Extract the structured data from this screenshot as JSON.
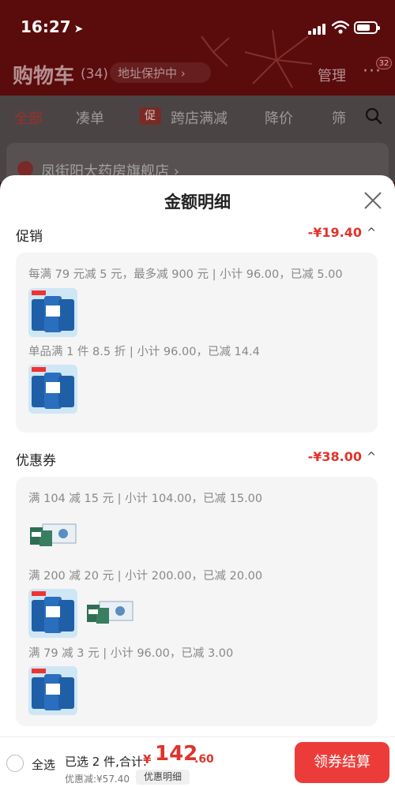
{
  "status_bar": {
    "time": "16:27"
  },
  "header": {
    "title": "购物车",
    "count": "(34)",
    "address_protection": "地址保护中 ›",
    "manage": "管理",
    "more_badge": "32"
  },
  "tabs": [
    {
      "label": "全部"
    },
    {
      "label": "凑单"
    },
    {
      "label": "跨店满减"
    },
    {
      "label": "降价"
    },
    {
      "label": "筛"
    }
  ],
  "promo_tag": "促",
  "store": {
    "name": "凤街阳大药房旗舰店 ›"
  },
  "sheet": {
    "title": "金额明细",
    "promotion": {
      "name": "促销",
      "amount": "-¥19.40",
      "rules": [
        "每满 79 元减 5 元，最多减 900 元 | 小计 96.00，已减 5.00",
        "单品满 1 件 8.5 折 | 小计 96.00，已减 14.4"
      ]
    },
    "coupon": {
      "name": "优惠券",
      "amount": "-¥38.00",
      "rules": [
        "满 104 减 15 元 | 小计 104.00，已减 15.00",
        "满 200 减 20 元 | 小计 200.00，已减 20.00",
        "满 79 减 3 元 | 小计 96.00，已减 3.00"
      ]
    }
  },
  "bottom_bar": {
    "select_all": "全选",
    "selected": "已选 2 件,合计:",
    "currency": "¥",
    "total_int": "142",
    "total_dec": ".60",
    "discount": "优惠减:¥57.40",
    "detail": "优惠明细",
    "checkout": "领券结算"
  },
  "colors": {
    "accent": "#ec3c3a",
    "price": "#e0332b",
    "header_bg": "#5a0b0c"
  }
}
